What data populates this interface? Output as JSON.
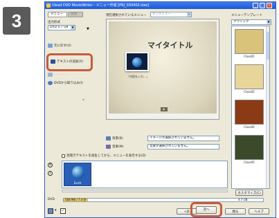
{
  "step_number": "3",
  "window": {
    "title": "Ulead DVD MovieWriter - メニュー作成 [PRJ_030402.dwz]"
  },
  "left": {
    "tabs": [
      "メニュー",
      "追加"
    ],
    "output_format_label": "出力形式",
    "output_format_value": "DVD 4.7 GB",
    "item_undo": "元に戻す(U)",
    "item_add_text": "テキストの追加(X)",
    "item_dvd_import": "DVDから取り込み(I)"
  },
  "center": {
    "current_menu_label": "現在選択されているメニュー",
    "current_menu_value": "ポンメニュー",
    "preview_title": "マイタイトル",
    "preview_thumb_caption": "「内容を入力...」",
    "music_label": "背景(B)",
    "music_value": "イメージが選択されていません。",
    "sound_label": "音楽(M)",
    "sound_value": "音楽が選択されていません。",
    "autoplay_label": "見開きテキストを再生してから、メニューを表示する(D)",
    "clip_caption": "Earth"
  },
  "right": {
    "template_label": "メニューテンプレート",
    "template_category": "クラシック",
    "templates": [
      {
        "caption": "Class01",
        "color": "#d9c27a"
      },
      {
        "caption": "Class02",
        "color": "#e8d59a"
      },
      {
        "caption": "Class04",
        "color": "#8a3a14"
      },
      {
        "caption": "Class05",
        "color": "#3b4a2a"
      }
    ],
    "customize_button": "カスタマイズ(C)"
  },
  "bottom": {
    "disc_label": "DVD",
    "usage_value": "568 MB / 7.4 秒",
    "capacity": "4.7 GB",
    "back_button": "<戻",
    "next_button": "次へ",
    "close_button": "閉る",
    "help_button": "ヘルプ"
  }
}
